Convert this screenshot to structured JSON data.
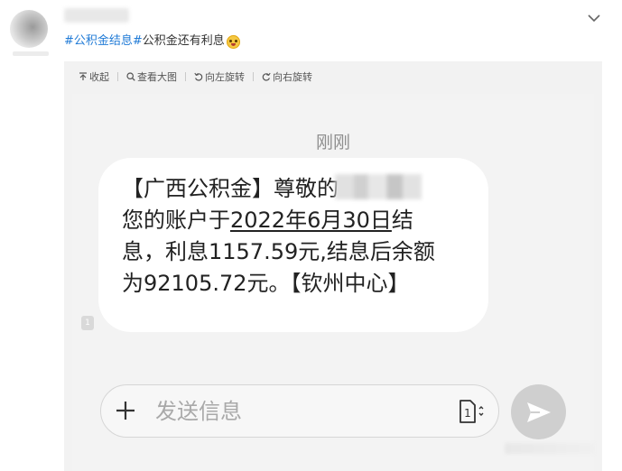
{
  "post": {
    "hashtag": "#公积金结息#",
    "text": "公积金还有利息",
    "emoji": "astonished-face-emoji"
  },
  "toolbar": {
    "collapse": "收起",
    "view_large": "查看大图",
    "rotate_left": "向左旋转",
    "rotate_right": "向右旋转"
  },
  "sms": {
    "time": "刚刚",
    "line1": "【广西公积金】尊敬的",
    "line2_prefix": "您的账户于",
    "line2_date": "2022年6月30日",
    "line2_suffix": "结",
    "line3": "息，利息1157.59元,结息后余额",
    "line4": "为92105.72元。【钦州中心】",
    "sim_badge": "1"
  },
  "compose": {
    "placeholder": "发送信息",
    "sim_slot": "1"
  },
  "colors": {
    "hashtag": "#1f7ad6",
    "viewer_bg": "#f2f2f2",
    "send_button": "#cfcfcf"
  }
}
